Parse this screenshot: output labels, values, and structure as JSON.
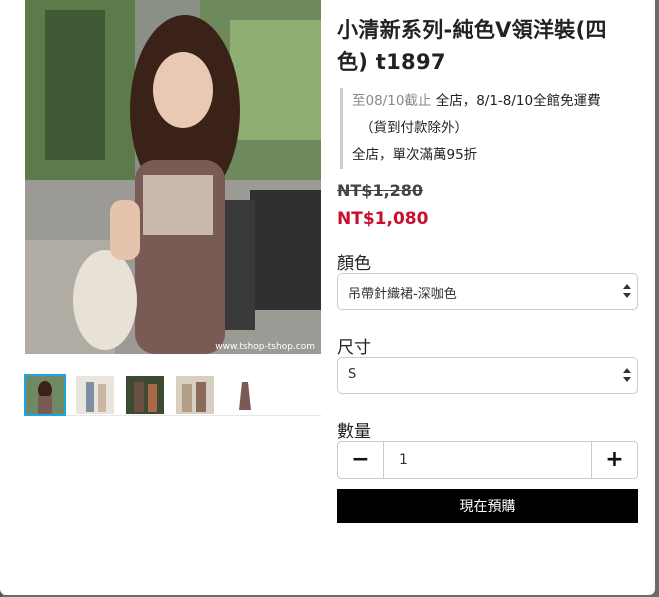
{
  "product": {
    "title": "小清新系列-純色V領洋裝(四色) t1897",
    "promo_date": "至08/10截止",
    "promo_line1": " 全店，8/1-8/10全館免運費",
    "promo_line2": "（貨到付款除外）",
    "promo_line3": "全店，單次滿萬95折",
    "price_original": "NT$1,280",
    "price_sale": "NT$1,080",
    "watermark": "www.tshop-tshop.com"
  },
  "options": {
    "color_label": "顏色",
    "color_selected": "吊帶針織裙-深咖色",
    "size_label": "尺寸",
    "size_selected": "S",
    "qty_label": "數量",
    "qty_value": "1",
    "minus_symbol": "−",
    "plus_symbol": "+"
  },
  "actions": {
    "preorder_label": "現在預購"
  },
  "thumbnails": [
    "thumb-1",
    "thumb-2",
    "thumb-3",
    "thumb-4",
    "thumb-5"
  ],
  "colors": {
    "sale_price": "#c8102e",
    "thumb_active_border": "#1fa6e0",
    "buy_button_bg": "#000000"
  }
}
